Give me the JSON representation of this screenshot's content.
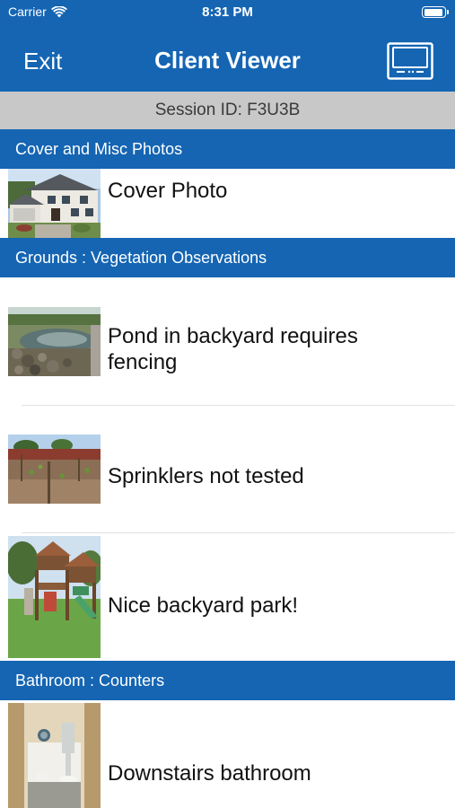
{
  "status_bar": {
    "carrier": "Carrier",
    "time": "8:31 PM"
  },
  "nav": {
    "exit_label": "Exit",
    "title": "Client Viewer",
    "screen_icon": "monitor-icon"
  },
  "session": {
    "label": "Session ID: F3U3B"
  },
  "sections": [
    {
      "title": "Cover and Misc Photos",
      "items": [
        {
          "label": "Cover Photo",
          "image": "house-photo"
        }
      ]
    },
    {
      "title": "Grounds : Vegetation Observations",
      "items": [
        {
          "label": "Pond in backyard requires fencing",
          "image": "pond-photo"
        },
        {
          "label": "Sprinklers not tested",
          "image": "garden-photo"
        },
        {
          "label": "Nice backyard park!",
          "image": "playset-photo"
        }
      ]
    },
    {
      "title": "Bathroom : Counters",
      "items": [
        {
          "label": "Downstairs bathroom",
          "image": "bathroom-photo"
        }
      ]
    }
  ],
  "colors": {
    "brand_blue": "#1565b3",
    "session_bar": "#c8c8c8"
  }
}
